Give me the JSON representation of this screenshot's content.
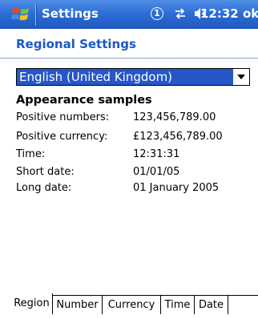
{
  "titlebar": {
    "app_title": "Settings",
    "notification_badge": "1",
    "clock": "12:32",
    "ok_label": "ok"
  },
  "page": {
    "title": "Regional Settings"
  },
  "locale_select": {
    "value": "English (United Kingdom)"
  },
  "samples": {
    "heading": "Appearance samples",
    "rows": [
      {
        "label": "Positive numbers:",
        "value": "123,456,789.00"
      },
      {
        "label": "Positive currency:",
        "value": "£123,456,789.00"
      },
      {
        "label": "Time:",
        "value": "12:31:31"
      },
      {
        "label": "Short date:",
        "value": "01/01/05"
      },
      {
        "label": "Long date:",
        "value": "01 January 2005"
      }
    ]
  },
  "tabs": [
    {
      "label": "Region",
      "active": true
    },
    {
      "label": "Number",
      "active": false
    },
    {
      "label": "Currency",
      "active": false
    },
    {
      "label": "Time",
      "active": false
    },
    {
      "label": "Date",
      "active": false
    }
  ],
  "colors": {
    "titlebar": "#2d6ed6",
    "page_title": "#1a58c6",
    "selection": "#2557c9"
  },
  "icons": {
    "start": "windows-flag-icon",
    "notification": "notification-icon",
    "connectivity": "connectivity-icon",
    "volume": "volume-icon",
    "dropdown": "chevron-down-icon"
  }
}
